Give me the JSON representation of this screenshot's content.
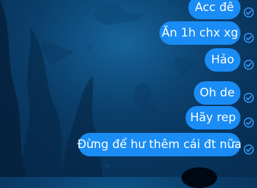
{
  "background": {
    "theme": "underwater",
    "colors": {
      "base": "#0a3f6d",
      "deep": "#072f55",
      "bubble": "#1a8cf5"
    }
  },
  "messages": [
    {
      "text": "Acc đê",
      "status_icon": "sent-check-icon"
    },
    {
      "text": "Ăn 1h chx xg",
      "status_icon": "sent-check-icon"
    },
    {
      "text": "Hảo",
      "status_icon": "sent-check-icon"
    },
    {
      "text": "Oh de",
      "status_icon": "sent-check-icon"
    },
    {
      "text": "Hãy rep",
      "status_icon": "sent-check-icon"
    },
    {
      "text": "Đừng để hư thêm cái đt nữa",
      "status_icon": "sent-check-icon"
    }
  ]
}
